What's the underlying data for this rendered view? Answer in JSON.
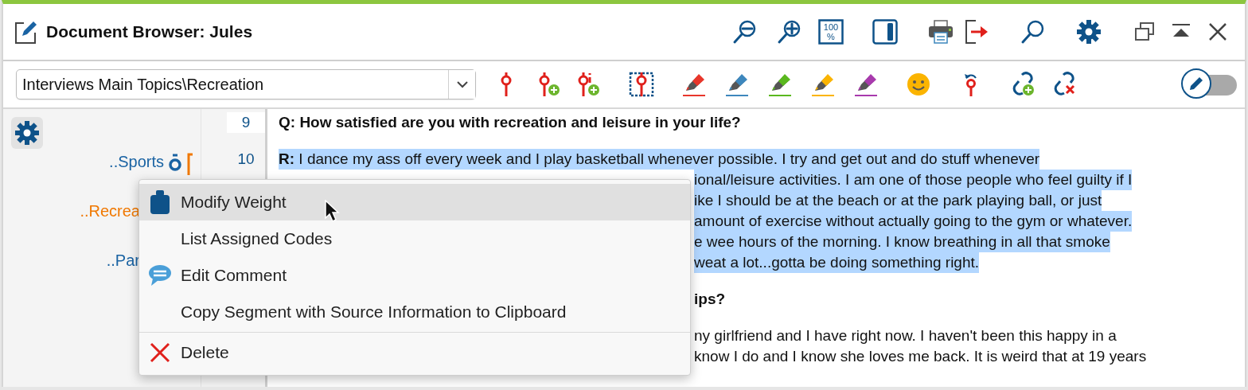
{
  "window": {
    "title": "Document Browser: Jules"
  },
  "title_tools": [
    {
      "kind": "zoom-out"
    },
    {
      "kind": "zoom-in"
    },
    {
      "kind": "zoom-reset",
      "label": "100",
      "sub": "%"
    },
    {
      "kind": "panel"
    },
    {
      "kind": "print"
    },
    {
      "kind": "export"
    },
    {
      "kind": "search"
    },
    {
      "kind": "settings"
    },
    {
      "kind": "restore"
    },
    {
      "kind": "collapse"
    },
    {
      "kind": "close"
    }
  ],
  "toolbar": {
    "dropdown": {
      "value": "Interviews Main Topics\\Recreation"
    },
    "tools": [
      {
        "kind": "code"
      },
      {
        "kind": "code-add"
      },
      {
        "kind": "code-info-add"
      },
      {
        "kind": "code-select"
      },
      {
        "kind": "highlighter",
        "color": "#e8362b"
      },
      {
        "kind": "highlighter",
        "color": "#3d87bd"
      },
      {
        "kind": "highlighter",
        "color": "#5ab81e"
      },
      {
        "kind": "highlighter",
        "color": "#fbb400"
      },
      {
        "kind": "highlighter",
        "color": "#a83aad"
      },
      {
        "kind": "emoji"
      },
      {
        "kind": "undo-code"
      },
      {
        "kind": "link-add"
      },
      {
        "kind": "link-remove"
      }
    ],
    "edit_mode": {
      "on": false
    }
  },
  "codes": [
    {
      "label": "..Sports",
      "color": "#1a63a3",
      "weighted": true,
      "kind": "full"
    },
    {
      "label": "..Recrea",
      "color": "#f07800",
      "weighted": false,
      "kind": "fragment"
    },
    {
      "label": "..Par",
      "color": "#1a63a3",
      "weighted": false,
      "kind": "fragment"
    }
  ],
  "line_numbers": [
    "9",
    "10"
  ],
  "document": [
    {
      "kind": "question",
      "lines": [
        {
          "text": "Q: How satisfied are you with recreation and leisure in your life?",
          "kind": "full",
          "selected": false
        }
      ]
    },
    {
      "kind": "answer",
      "lines": [
        {
          "text": "**R:** I dance my ass off every week and I play basketball whenever possible. I try and get out and do stuff whenever",
          "kind": "full",
          "selected": true
        },
        {
          "text": "ional/leisure activities. I am one of those people who feel guilty if I",
          "kind": "fragment",
          "selected": true
        },
        {
          "text": "ike I should be at the beach or at the park playing ball, or just",
          "kind": "fragment",
          "selected": true
        },
        {
          "text": "amount of exercise without actually going to the gym or whatever.",
          "kind": "fragment",
          "selected": true
        },
        {
          "text": "e wee hours of the morning. I know breathing in all that smoke",
          "kind": "fragment",
          "selected": true
        },
        {
          "text": "weat a lot...gotta be doing something right.",
          "kind": "fragment",
          "selected": true
        }
      ]
    },
    {
      "kind": "question",
      "lines": [
        {
          "text": "ips?",
          "kind": "fragment",
          "selected": false
        }
      ]
    },
    {
      "kind": "answer",
      "lines": [
        {
          "text": "ny girlfriend and I have right now. I haven't been this happy in a",
          "kind": "fragment",
          "selected": false
        },
        {
          "text": "know I do and I know she loves me back. It is weird that at 19 years",
          "kind": "fragment",
          "selected": false
        }
      ]
    }
  ],
  "context_menu": {
    "groups": [
      [
        {
          "label": "Modify Weight",
          "kind": "weight",
          "selected": true
        },
        {
          "label": "List Assigned Codes",
          "kind": "plain",
          "selected": false
        },
        {
          "label": "Edit Comment",
          "kind": "comment",
          "selected": false
        },
        {
          "label": "Copy Segment with Source Information to Clipboard",
          "kind": "plain",
          "selected": false
        }
      ],
      [
        {
          "label": "Delete",
          "kind": "delete",
          "selected": false
        }
      ]
    ]
  }
}
